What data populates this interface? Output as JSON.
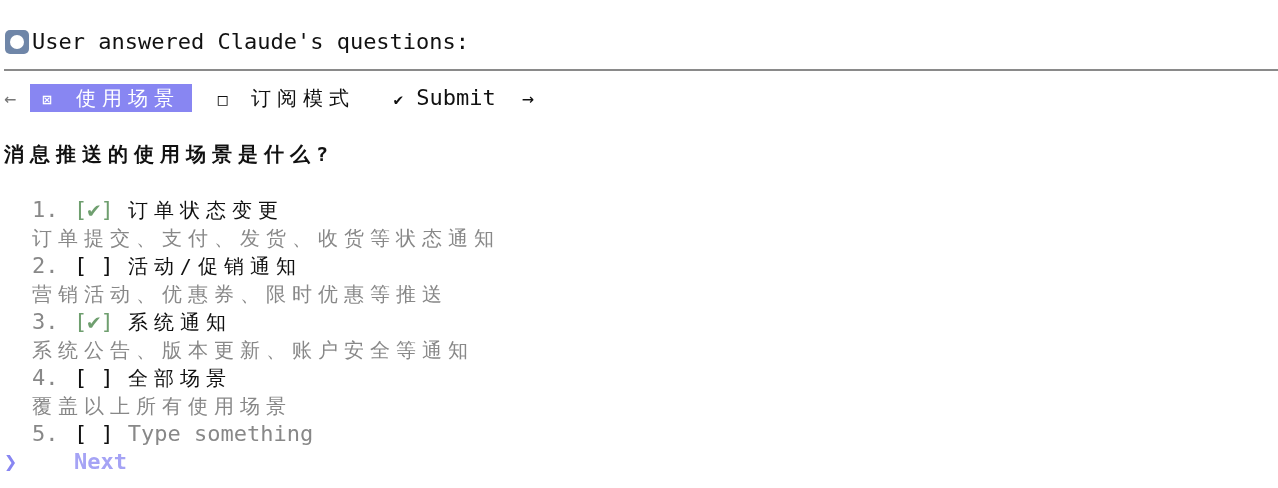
{
  "header": {
    "title": "User answered Claude's questions:"
  },
  "nav": {
    "back": "←",
    "forward": "→",
    "tabs": [
      {
        "mark": "⊠",
        "label": "使用场景",
        "selected": true
      },
      {
        "mark": "□",
        "label": "订阅模式",
        "selected": false
      },
      {
        "mark": "✔",
        "label": "Submit",
        "selected": false,
        "kind": "submit"
      }
    ]
  },
  "question": "消息推送的使用场景是什么?",
  "options": [
    {
      "number": "1.",
      "checkbox": "[✔]",
      "checked": true,
      "label": "订单状态变更",
      "description": "订单提交、支付、发货、收货等状态通知",
      "kind": "choice"
    },
    {
      "number": "2.",
      "checkbox": "[ ]",
      "checked": false,
      "label": "活动/促销通知",
      "description": "营销活动、优惠券、限时优惠等推送",
      "kind": "choice"
    },
    {
      "number": "3.",
      "checkbox": "[✔]",
      "checked": true,
      "label": "系统通知",
      "description": "系统公告、版本更新、账户安全等通知",
      "kind": "choice"
    },
    {
      "number": "4.",
      "checkbox": "[ ]",
      "checked": false,
      "label": "全部场景",
      "description": "覆盖以上所有使用场景",
      "kind": "choice"
    },
    {
      "number": "5.",
      "checkbox": "[ ]",
      "checked": false,
      "placeholder": "Type something",
      "kind": "other"
    }
  ],
  "footer": {
    "pointer": "❯",
    "action": "Next"
  }
}
